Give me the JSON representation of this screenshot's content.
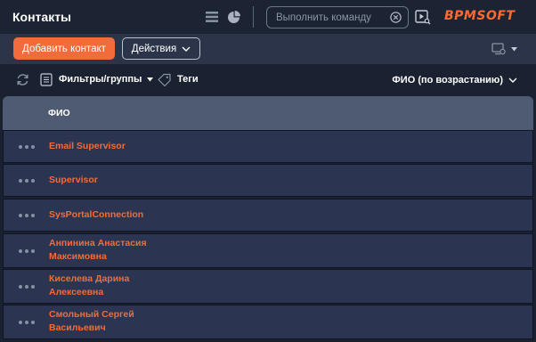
{
  "header": {
    "title": "Контакты",
    "command_placeholder": "Выполнить команду",
    "logo_bpm": "BPM",
    "logo_soft": "SOFT"
  },
  "actions": {
    "add_label": "Добавить контакт",
    "actions_label": "Действия"
  },
  "filters": {
    "filters_label": "Фильтры/группы",
    "tags_label": "Теги",
    "sort_label": "ФИО (по возрастанию)"
  },
  "grid": {
    "column_header": "ФИО",
    "rows": [
      {
        "name": "Email Supervisor"
      },
      {
        "name": "Supervisor"
      },
      {
        "name": "SysPortalConnection"
      },
      {
        "name": "Анпинина Анастасия Максимовна",
        "line1": "Анпинина Анастасия",
        "line2": "Максимовна"
      },
      {
        "name": "Киселева Дарина Алексеевна",
        "line1": "Киселева Дарина",
        "line2": "Алексеевна"
      },
      {
        "name": "Смольный Сергей Васильевич",
        "line1": "Смольный Сергей",
        "line2": "Васильевич"
      }
    ]
  },
  "colors": {
    "accent": "#f26b3a",
    "header_bg": "#1c2433",
    "toolbar_bg": "#2b3448",
    "grid_header_bg": "#4f5b73",
    "row_bg": "#2b3552"
  },
  "icons": [
    "list-view-icon",
    "chart-view-icon",
    "clear-icon",
    "run-command-icon",
    "view-settings-icon",
    "chevron-down-icon",
    "refresh-icon",
    "filter-icon",
    "tag-icon",
    "row-menu-icon"
  ]
}
